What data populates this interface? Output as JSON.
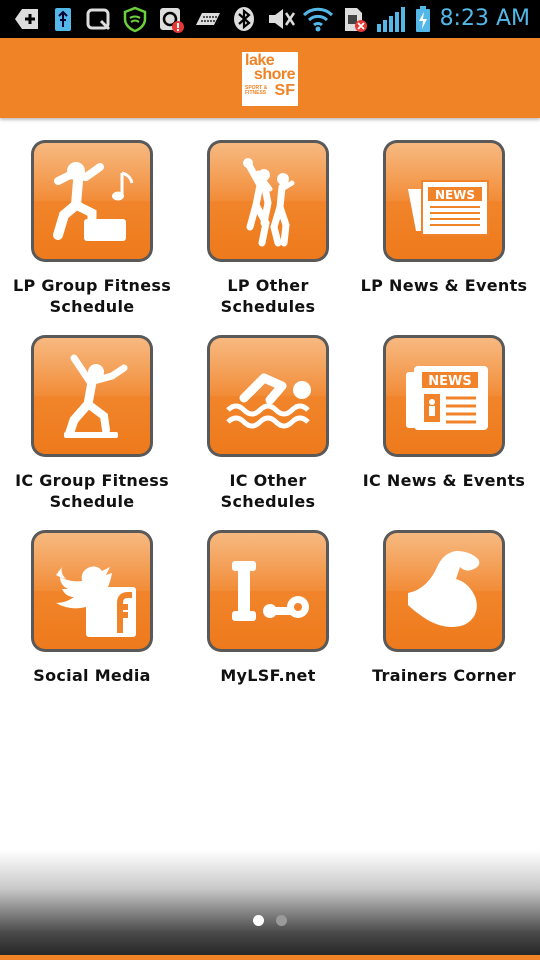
{
  "status_bar": {
    "time": "8:23 AM",
    "icons": [
      "add-icon",
      "usb-icon",
      "search-app-icon",
      "shield-icon",
      "at-notification-icon",
      "keyboard-icon",
      "bluetooth-icon",
      "mute-icon",
      "wifi-icon",
      "sim-missing-icon",
      "signal-icon",
      "battery-charging-icon"
    ]
  },
  "header": {
    "logo": {
      "line1": "lake",
      "line2": "shore",
      "small1": "SPORT &",
      "small2": "FITNESS",
      "sf": "SF"
    }
  },
  "tiles": [
    {
      "label_line1": "LP Group Fitness",
      "label_line2": "Schedule",
      "icon": "dance-step-icon"
    },
    {
      "label_line1": "LP Other",
      "label_line2": "Schedules",
      "icon": "basketball-players-icon"
    },
    {
      "label_line1": "LP News & Events",
      "label_line2": "",
      "icon": "newspaper-icon"
    },
    {
      "label_line1": "IC Group Fitness",
      "label_line2": "Schedule",
      "icon": "aerobics-icon"
    },
    {
      "label_line1": "IC Other",
      "label_line2": "Schedules",
      "icon": "swimmer-icon"
    },
    {
      "label_line1": "IC News & Events",
      "label_line2": "",
      "icon": "news-document-icon"
    },
    {
      "label_line1": "Social Media",
      "label_line2": "",
      "icon": "twitter-facebook-icon"
    },
    {
      "label_line1": "MyLSF.net",
      "label_line2": "",
      "icon": "dumbbells-icon"
    },
    {
      "label_line1": "Trainers Corner",
      "label_line2": "",
      "icon": "flexed-arm-icon"
    }
  ],
  "pager": {
    "pages": 2,
    "current": 1
  },
  "colors": {
    "accent": "#f08325",
    "status_bar": "#000000",
    "status_text": "#53b8e8"
  }
}
